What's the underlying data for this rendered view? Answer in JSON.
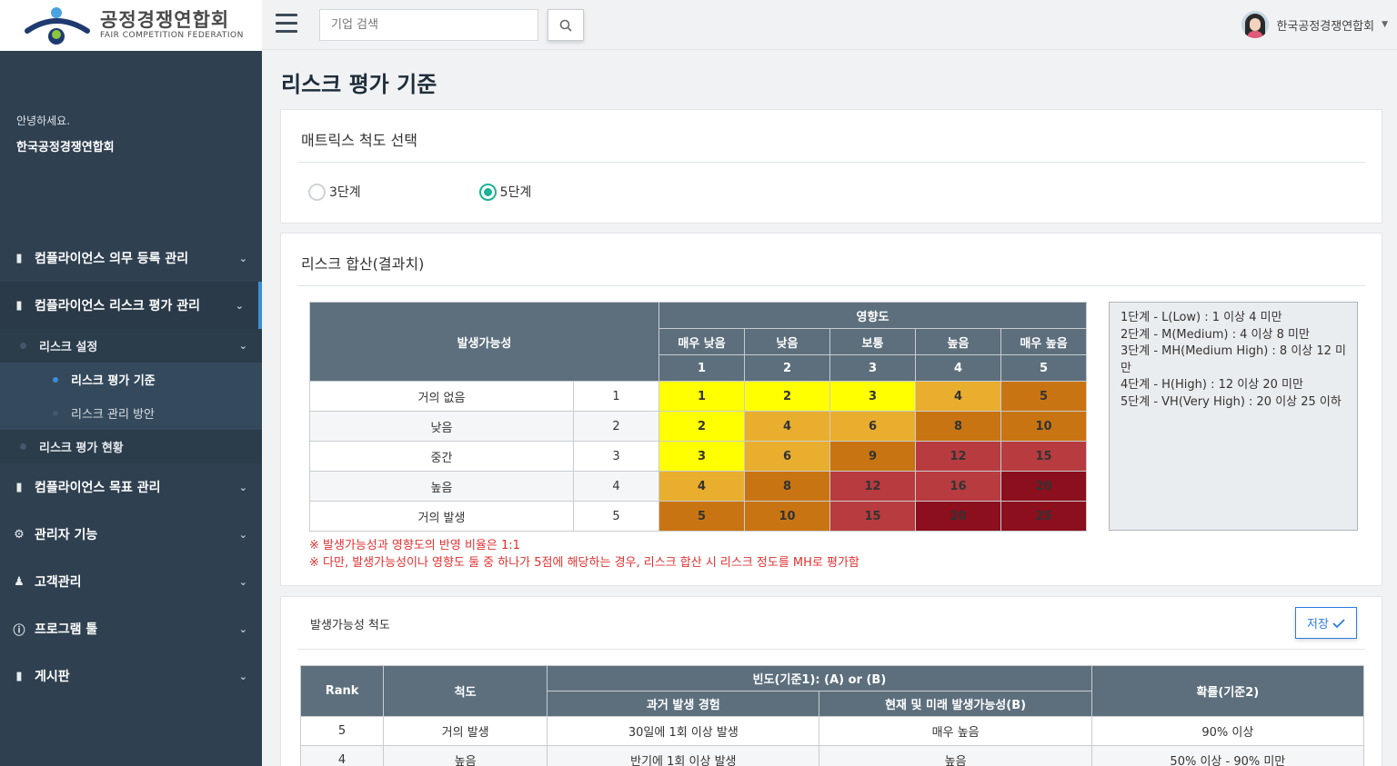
{
  "logo": {
    "kr": "공정경쟁연합회",
    "en": "FAIR COMPETITION FEDERATION"
  },
  "greeting": {
    "hello": "안녕하세요.",
    "org": "한국공정경쟁연합회"
  },
  "menu": [
    {
      "label": "컴플라이언스 의무 등록 관리",
      "icon": "clipboard-icon"
    },
    {
      "label": "컴플라이언스 리스크 평가 관리",
      "icon": "clipboard-icon"
    },
    {
      "label": "컴플라이언스 목표 관리",
      "icon": "clipboard-icon"
    },
    {
      "label": "관리자 기능",
      "icon": "gear-icon"
    },
    {
      "label": "고객관리",
      "icon": "users-icon"
    },
    {
      "label": "프로그램 툴",
      "icon": "info-icon"
    },
    {
      "label": "게시판",
      "icon": "clipboard-icon"
    }
  ],
  "submenu": {
    "risk_setting": "리스크 설정",
    "risk_criteria": "리스크 평가 기준",
    "risk_plan": "리스크 관리 방안",
    "risk_status": "리스크 평가 현황"
  },
  "search": {
    "placeholder": "기업 검색"
  },
  "user": {
    "name": "한국공정경쟁연합회"
  },
  "page": {
    "title": "리스크 평가 기준"
  },
  "matrix_panel": {
    "title": "매트릭스 척도 선택",
    "options": [
      "3단계",
      "5단계"
    ],
    "selected": "5단계"
  },
  "risk_panel": {
    "title": "리스크 합산(결과치)",
    "likelihood_header": "발생가능성",
    "impact_header": "영향도",
    "impact_levels": [
      "매우 낮음",
      "낮음",
      "보통",
      "높음",
      "매우 높음"
    ],
    "impact_scores": [
      "1",
      "2",
      "3",
      "4",
      "5"
    ],
    "rows": [
      {
        "label": "거의 없음",
        "score": "1",
        "cells": [
          "1",
          "2",
          "3",
          "4",
          "5"
        ]
      },
      {
        "label": "낮음",
        "score": "2",
        "cells": [
          "2",
          "4",
          "6",
          "8",
          "10"
        ]
      },
      {
        "label": "중간",
        "score": "3",
        "cells": [
          "3",
          "6",
          "9",
          "12",
          "15"
        ]
      },
      {
        "label": "높음",
        "score": "4",
        "cells": [
          "4",
          "8",
          "12",
          "16",
          "20"
        ]
      },
      {
        "label": "거의 발생",
        "score": "5",
        "cells": [
          "5",
          "10",
          "15",
          "20",
          "25"
        ]
      }
    ],
    "legend": [
      "1단계 - L(Low) : 1 이상 4 미만",
      "2단계 - M(Medium) : 4 이상 8 미만",
      "3단계 - MH(Medium High) : 8 이상 12 미만",
      "4단계 - H(High) : 12 이상 20 미만",
      "5단계 - VH(Very High) : 20 이상 25 이하"
    ],
    "notes": [
      "※ 발생가능성과 영향도의 반영 비율은 1:1",
      "※ 다만, 발생가능성이나 영향도 둘 중 하나가 5점에 해당하는 경우, 리스크 합산 시 리스크 정도를 MH로 평가함"
    ],
    "colors": {
      "yellow": "#ffff00",
      "orange": "#e9ae2e",
      "dark_orange": "#c97412",
      "red": "#b83b3f",
      "maroon": "#8b0f1c"
    }
  },
  "scale_panel": {
    "title": "발생가능성 척도",
    "save_label": "저장",
    "headers": {
      "rank": "Rank",
      "scale": "척도",
      "freq": "빈도(기준1): (A) or (B)",
      "past": "과거 발생 경험",
      "future": "현재 및 미래 발생가능성(B)",
      "prob": "확률(기준2)"
    },
    "rows": [
      {
        "rank": "5",
        "scale": "거의 발생",
        "past": "30일에 1회 이상 발생",
        "future": "매우 높음",
        "prob": "90% 이상"
      },
      {
        "rank": "4",
        "scale": "높음",
        "past": "반기에 1회 이상 발생",
        "future": "높음",
        "prob": "50% 이상 - 90% 미만"
      }
    ]
  }
}
